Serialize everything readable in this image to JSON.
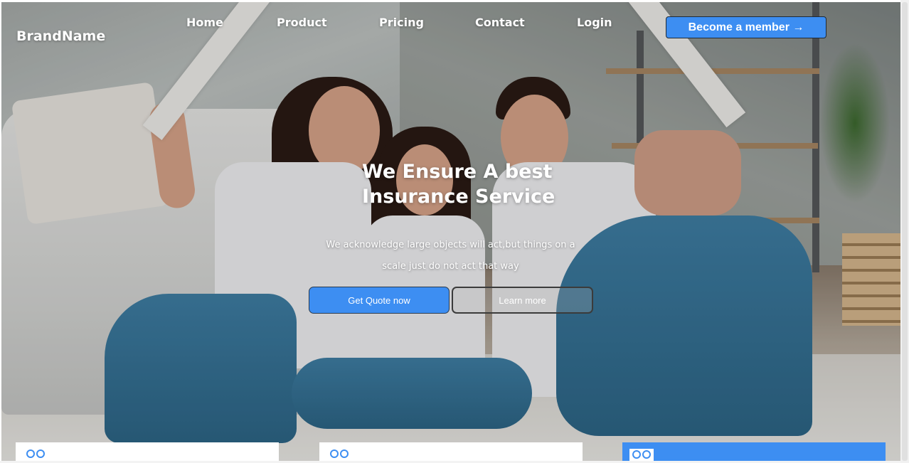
{
  "brand": {
    "name": "BrandName"
  },
  "nav": {
    "items": [
      {
        "label": "Home"
      },
      {
        "label": "Product"
      },
      {
        "label": "Pricing"
      },
      {
        "label": "Contact"
      },
      {
        "label": "Login"
      }
    ],
    "cta_label": "Become a member →"
  },
  "hero": {
    "title_line1": "We Ensure A best",
    "title_line2": "Insurance Service",
    "subtitle_line1": "We acknowledge large objects will act,but things on a",
    "subtitle_line2": "scale just do not act that way",
    "primary_button": "Get Quote now",
    "secondary_button": "Learn more"
  },
  "cards": [
    {
      "icon": "rings-icon",
      "active": false
    },
    {
      "icon": "rings-icon",
      "active": false
    },
    {
      "icon": "rings-icon",
      "active": true
    }
  ],
  "colors": {
    "accent": "#3d8ef2",
    "text_on_hero": "#ffffff"
  }
}
